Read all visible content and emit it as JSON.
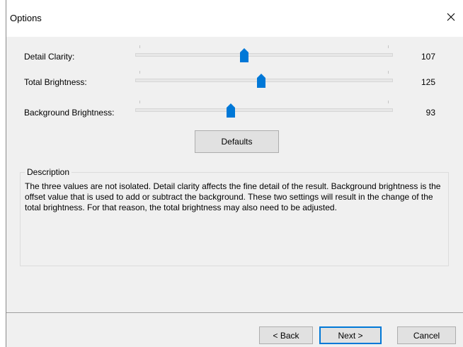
{
  "window": {
    "title": "Options"
  },
  "icons": {
    "close": "close-icon",
    "thumb": "slider-thumb"
  },
  "colors": {
    "accent": "#0078d7",
    "background": "#f0f0f0"
  },
  "sliders": [
    {
      "label": "Detail Clarity:",
      "value": "107",
      "fraction": 0.42
    },
    {
      "label": "Total Brightness:",
      "value": "125",
      "fraction": 0.49
    },
    {
      "label": "Background Brightness:",
      "value": "93",
      "fraction": 0.367
    }
  ],
  "buttons": {
    "defaults": "Defaults",
    "back": "< Back",
    "next": "Next >",
    "cancel": "Cancel"
  },
  "description": {
    "legend": "Description",
    "text": "The three values are not isolated. Detail clarity affects the fine detail of the result. Background brightness is the offset value that is used to add or subtract the background. These two settings will result in the change of the total brightness. For that reason, the total brightness may also need to be adjusted."
  }
}
